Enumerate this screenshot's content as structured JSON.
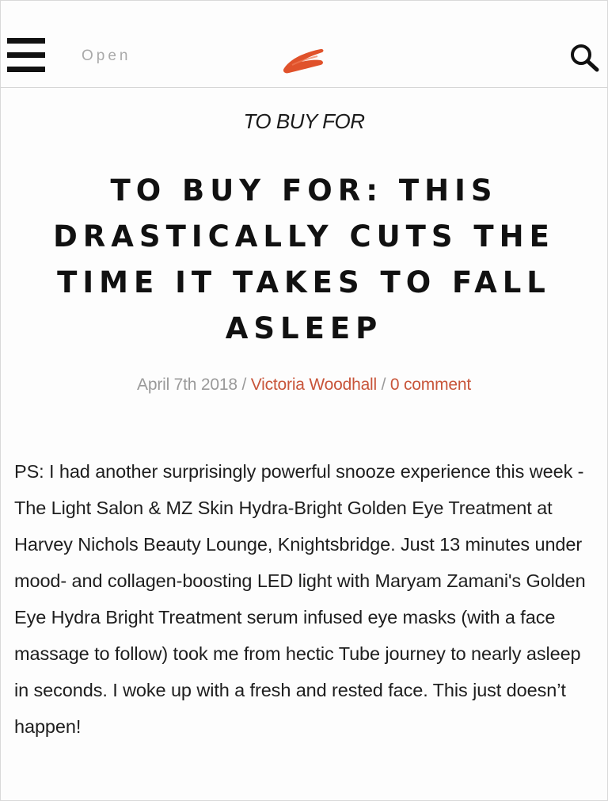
{
  "header": {
    "open_label": "Open",
    "icons": {
      "menu": "hamburger-menu-icon",
      "logo": "brush-stroke-logo",
      "search": "search-icon"
    },
    "logo_color": "#e0522b"
  },
  "article": {
    "category": "TO BUY FOR",
    "title": "TO BUY FOR: THIS DRASTICALLY CUTS THE TIME IT TAKES TO FALL ASLEEP",
    "meta": {
      "date": "April 7th 2018",
      "separator_1": " / ",
      "author": "Victoria Woodhall",
      "separator_2": " / ",
      "comments": "0 comment"
    },
    "body": "PS: I had another surprisingly powerful snooze experience this week - The Light Salon & MZ Skin Hydra-Bright Golden Eye Treatment at Harvey Nichols Beauty Lounge, Knightsbridge. Just 13 minutes under mood- and collagen-boosting LED light with Maryam Zamani's Golden Eye Hydra Bright Treatment serum infused eye masks (with a face massage to follow) took me from hectic Tube journey to nearly asleep in seconds. I woke up with a fresh and rested face. This just doesn’t happen!"
  },
  "colors": {
    "accent": "#c8553a",
    "meta_gray": "#9a9a9a",
    "text": "#1e1e1e"
  }
}
